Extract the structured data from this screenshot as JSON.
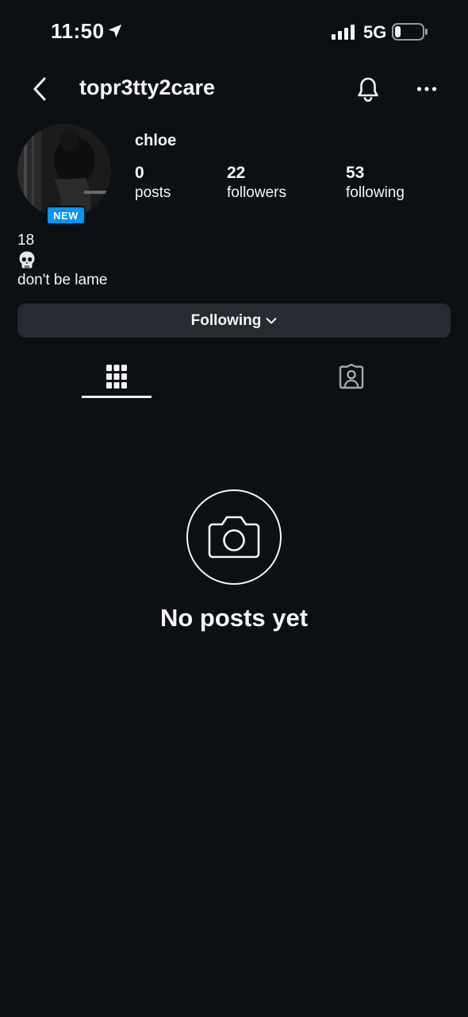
{
  "status_bar": {
    "time": "11:50",
    "network": "5G",
    "icons": [
      "location-arrow-icon",
      "signal-bars-icon",
      "battery-icon"
    ]
  },
  "header": {
    "username": "topr3tty2care",
    "icons": [
      "back-arrow-icon",
      "bell-icon",
      "more-dots-icon"
    ]
  },
  "profile": {
    "display_name": "chloe",
    "badge": "NEW",
    "stats": [
      {
        "value": "0",
        "label": "posts"
      },
      {
        "value": "22",
        "label": "followers"
      },
      {
        "value": "53",
        "label": "following"
      }
    ],
    "bio": {
      "line1": "18",
      "emoji_icon": "skull-icon",
      "line3": "don't be lame"
    }
  },
  "actions": {
    "following_label": "Following"
  },
  "tabs": [
    {
      "icon": "grid-icon",
      "active": true
    },
    {
      "icon": "tagged-person-icon",
      "active": false
    }
  ],
  "empty_state": {
    "icon": "camera-icon",
    "title": "No posts yet"
  },
  "colors": {
    "background": "#0c1014",
    "button_bg": "#262a31",
    "badge_blue": "#0095f6",
    "text": "#f5f5f5"
  }
}
